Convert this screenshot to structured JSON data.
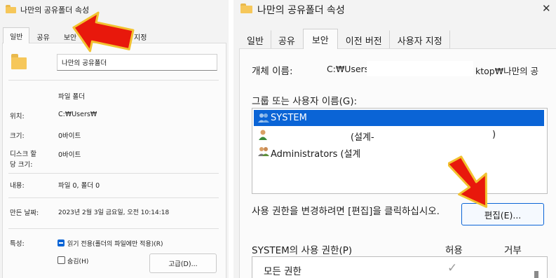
{
  "left": {
    "title": "나만의 공유폴더 속성",
    "tabs": [
      "일반",
      "공유",
      "보안",
      "사용자 지정"
    ],
    "folder_name_value": "나만의 공유폴더",
    "type_label": "파일 폴더",
    "props": [
      {
        "label": "위치:",
        "value": "C:₩Users₩"
      },
      {
        "label": "크기:",
        "value": "0바이트"
      },
      {
        "label": "디스크 할\n당 크기:",
        "value": "0바이트"
      },
      {
        "label": "내용:",
        "value": "파일 0, 폴더 0"
      },
      {
        "label": "만든 날짜:",
        "value": "2023년 2월 3일 금요일, 오전 10:14:18"
      },
      {
        "label": "특성:",
        "value": ""
      }
    ],
    "readonly_label": "읽기 전용(폴더의 파일에만 적용)(R)",
    "hidden_label": "숨김(H)",
    "advanced_button": "고급(D)..."
  },
  "right": {
    "title": "나만의 공유폴더 속성",
    "close_glyph": "✕",
    "tabs": [
      "일반",
      "공유",
      "보안",
      "이전 버전",
      "사용자 지정"
    ],
    "object_name_label": "개체 이름:",
    "object_name_value_left": "C:₩Users",
    "object_name_value_right": "ktop₩나만의 공",
    "groups_label": "그룹 또는 사용자 이름(G):",
    "users": [
      {
        "name": "SYSTEM",
        "selected": true,
        "icon": "group-icon"
      },
      {
        "name": "(설계-",
        "suffix": ")",
        "selected": false,
        "icon": "user-icon"
      },
      {
        "name": "Administrators (설계",
        "selected": false,
        "icon": "group-icon"
      }
    ],
    "change_note": "사용 권한을 변경하려면 [편집]을 클릭하십시오.",
    "edit_button": "편집(E)...",
    "perm_header": "SYSTEM의 사용 권한(P)",
    "allow_header": "허용",
    "deny_header": "거부",
    "perm_rows": [
      {
        "name": "모든 권한",
        "allow": "✓",
        "deny": ""
      }
    ]
  },
  "colors": {
    "selection": "#0a64d6",
    "arrow_red": "#e8180c",
    "arrow_gold": "#f2c230",
    "folder": "#f6c75a"
  }
}
